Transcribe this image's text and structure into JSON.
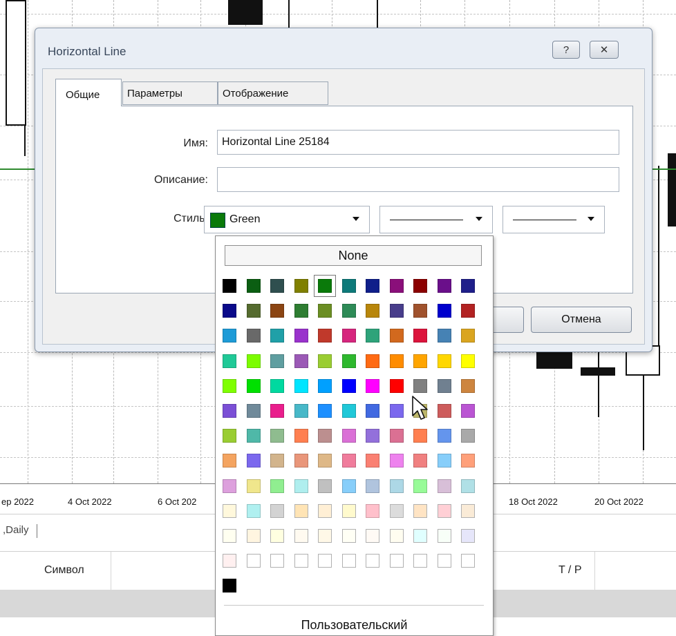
{
  "dialog": {
    "title": "Horizontal Line",
    "help_label": "?",
    "close_label": "✕",
    "tabs": [
      "Общие",
      "Параметры",
      "Отображение"
    ],
    "fields": {
      "name_label": "Имя:",
      "name_value": "Horizontal Line 25184",
      "description_label": "Описание:",
      "description_value": "",
      "style_label": "Стиль:"
    },
    "style": {
      "color_name": "Green",
      "color_value": "#0a7a0a"
    },
    "cancel_label": "Отмена"
  },
  "palette": {
    "none_label": "None",
    "custom_label": "Пользовательский",
    "selected_color": "Green",
    "rows": [
      [
        "#000000",
        "#0b5e12",
        "#2f4f4f",
        "#808000",
        "#0a7a0a",
        "#0e7a7a",
        "#0f1f8a",
        "#8a0f7a",
        "#8b0000",
        "#6a0f8a",
        "#1f1f8a"
      ],
      [
        "#0a0a8a",
        "#556b2f",
        "#8b4513",
        "#2e7d32",
        "#6b8e23",
        "#2e8b57",
        "#b8860b",
        "#483d8b",
        "#a0522d",
        "#0000cd",
        "#b22222"
      ],
      [
        "#1e9bd7",
        "#696969",
        "#20a0a8",
        "#9932cc",
        "#c0392b",
        "#d6267e",
        "#2ea37a",
        "#d2691e",
        "#dc143c",
        "#4682b4",
        "#daa520"
      ],
      [
        "#20c997",
        "#7cfc00",
        "#5f9ea0",
        "#9b59b6",
        "#9acd32",
        "#2eb82e",
        "#ff6a13",
        "#ff8c00",
        "#ffa500",
        "#ffd700",
        "#ffff00"
      ],
      [
        "#7fff00",
        "#00e000",
        "#00d9a0",
        "#00e5ff",
        "#00a0ff",
        "#0000ff",
        "#ff00ff",
        "#ff0000",
        "#808080",
        "#708090",
        "#cd853f"
      ],
      [
        "#7b4fd6",
        "#708a9a",
        "#e91e8c",
        "#48b8c8",
        "#1e90ff",
        "#20c8d8",
        "#4169e1",
        "#7b68ee",
        "#bdb76b",
        "#cd5c5c",
        "#ba55d3"
      ],
      [
        "#9acd32",
        "#4fb8a8",
        "#8fbc8f",
        "#ff7f50",
        "#bc8f8f",
        "#da70d6",
        "#9370db",
        "#db7093",
        "#ff7f50",
        "#6495ed",
        "#a9a9a9"
      ],
      [
        "#f4a460",
        "#7b68ee",
        "#d2b48c",
        "#e9967a",
        "#deb887",
        "#f07c9c",
        "#fa8072",
        "#ee82ee",
        "#f08080",
        "#87cefa",
        "#ffa07a"
      ],
      [
        "#dda0dd",
        "#f0e68c",
        "#90ee90",
        "#afeeee",
        "#c0c0c0",
        "#87cefa",
        "#b0c4de",
        "#add8e6",
        "#98fb98",
        "#d8bfd8",
        "#b0e0e6"
      ],
      [
        "#fff8dc",
        "#b0f0f0",
        "#d3d3d3",
        "#ffe4b5",
        "#ffefd5",
        "#fffacd",
        "#ffc0cb",
        "#dcdcdc",
        "#ffe4c4",
        "#ffcfd5",
        "#faebd7"
      ],
      [
        "#fffff0",
        "#fff5e0",
        "#ffffe0",
        "#fffaf0",
        "#fff8e7",
        "#fffff5",
        "#fffaf5",
        "#fffdf0",
        "#e0ffff",
        "#f8fff8",
        "#e6e6fa"
      ],
      [
        "#fff0f0",
        "#ffffff",
        "#ffffff",
        "#ffffff",
        "#ffffff",
        "#ffffff",
        "#ffffff",
        "#ffffff",
        "#ffffff",
        "#ffffff",
        "#ffffff"
      ],
      [
        "#000000"
      ]
    ]
  },
  "chart": {
    "dates": [
      "ep 2022",
      "4 Oct 2022",
      "6 Oct 202",
      "18 Oct 2022",
      "20 Oct 2022"
    ],
    "timeframe_tab": ",Daily",
    "table_headers": [
      "Символ",
      "T / P"
    ]
  }
}
